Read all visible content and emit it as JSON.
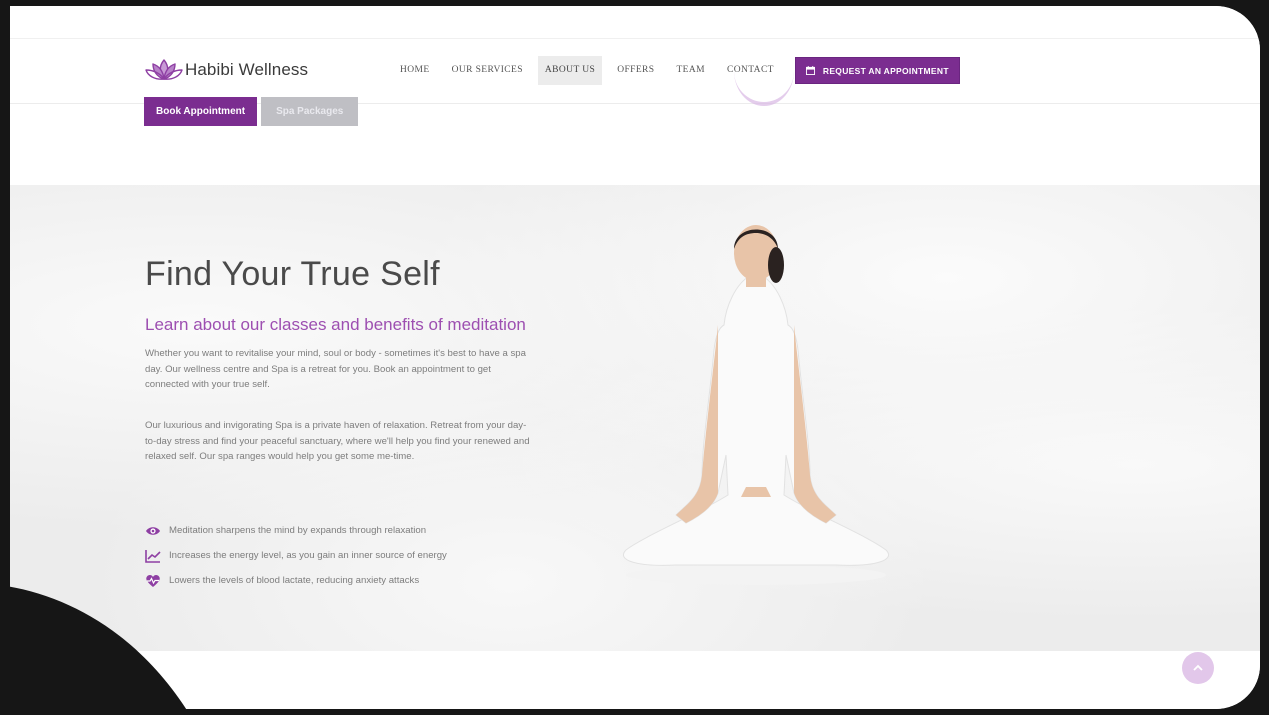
{
  "brand": {
    "name": "Habibi Wellness",
    "accent": "#7b2d90",
    "subtitle_color": "#9d4fb1"
  },
  "nav": {
    "items": [
      {
        "label": "HOME",
        "active": false
      },
      {
        "label": "OUR SERVICES",
        "active": false
      },
      {
        "label": "ABOUT US",
        "active": true
      },
      {
        "label": "OFFERS",
        "active": false
      },
      {
        "label": "TEAM",
        "active": false
      },
      {
        "label": "CONTACT",
        "active": false
      }
    ],
    "cta": {
      "label": "REQUEST AN APPOINTMENT",
      "icon": "calendar-icon"
    }
  },
  "top_buttons": {
    "book": "Book Appointment",
    "spa": "Spa Packages"
  },
  "hero": {
    "title": "Find Your True Self",
    "subtitle": "Learn about our classes and benefits of meditation",
    "paragraph1": "Whether you want to revitalise your mind, soul or body - sometimes it's best to have a spa day. Our wellness centre and Spa is a retreat for you. Book an appointment to get connected with your true self.",
    "paragraph2": "Our luxurious and invigorating Spa is a private haven of relaxation. Retreat from your day-to-day stress and find your peaceful sanctuary, where we'll help you find your renewed and relaxed self. Our spa ranges would help you get some me-time.",
    "benefits": [
      {
        "icon": "eye-icon",
        "text": "Meditation sharpens the mind by expands through relaxation"
      },
      {
        "icon": "line-chart-icon",
        "text": "Increases the energy level, as you gain an inner source of energy"
      },
      {
        "icon": "heartbeat-icon",
        "text": "Lowers the levels of blood lactate, reducing anxiety attacks"
      }
    ]
  },
  "scroll_top": {
    "icon": "chevron-up-icon"
  }
}
